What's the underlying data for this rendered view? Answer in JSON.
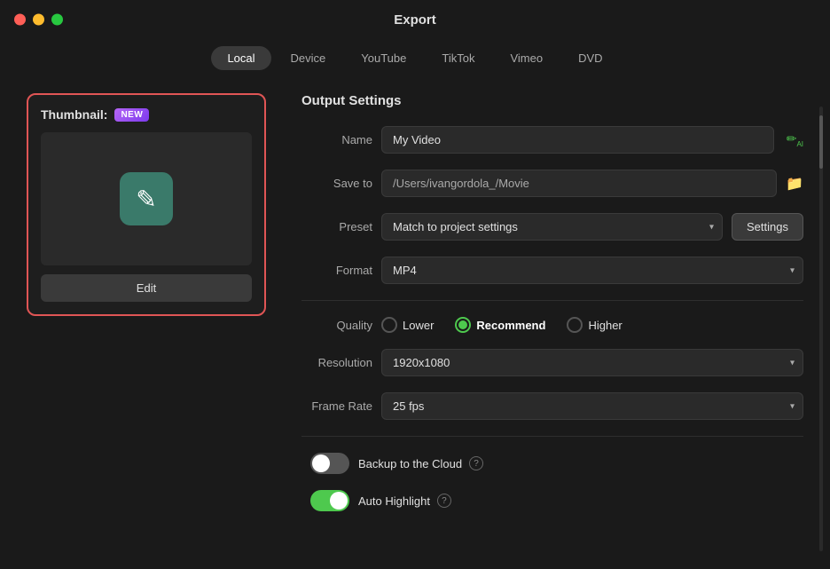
{
  "titleBar": {
    "title": "Export"
  },
  "tabs": [
    {
      "id": "local",
      "label": "Local",
      "active": true
    },
    {
      "id": "device",
      "label": "Device",
      "active": false
    },
    {
      "id": "youtube",
      "label": "YouTube",
      "active": false
    },
    {
      "id": "tiktok",
      "label": "TikTok",
      "active": false
    },
    {
      "id": "vimeo",
      "label": "Vimeo",
      "active": false
    },
    {
      "id": "dvd",
      "label": "DVD",
      "active": false
    }
  ],
  "thumbnail": {
    "label": "Thumbnail:",
    "badge": "NEW",
    "editButton": "Edit"
  },
  "outputSettings": {
    "sectionTitle": "Output Settings",
    "nameLabel": "Name",
    "nameValue": "My Video",
    "saveToLabel": "Save to",
    "saveToPath": "/Users/ivangordola_/Movie",
    "presetLabel": "Preset",
    "presetValue": "Match to project settings",
    "settingsButton": "Settings",
    "formatLabel": "Format",
    "formatValue": "MP4",
    "qualityLabel": "Quality",
    "qualityOptions": [
      {
        "id": "lower",
        "label": "Lower",
        "checked": false
      },
      {
        "id": "recommend",
        "label": "Recommend",
        "checked": true
      },
      {
        "id": "higher",
        "label": "Higher",
        "checked": false
      }
    ],
    "resolutionLabel": "Resolution",
    "resolutionValue": "1920x1080",
    "frameRateLabel": "Frame Rate",
    "frameRateValue": "25 fps",
    "backupLabel": "Backup to the Cloud",
    "backupEnabled": false,
    "autoHighlightLabel": "Auto Highlight",
    "autoHighlightEnabled": true
  },
  "icons": {
    "close": "⬤",
    "minimize": "⬤",
    "maximize": "⬤",
    "folder": "📁",
    "ai": "✏",
    "chevronDown": "▾",
    "help": "?",
    "pencil": "✎"
  }
}
